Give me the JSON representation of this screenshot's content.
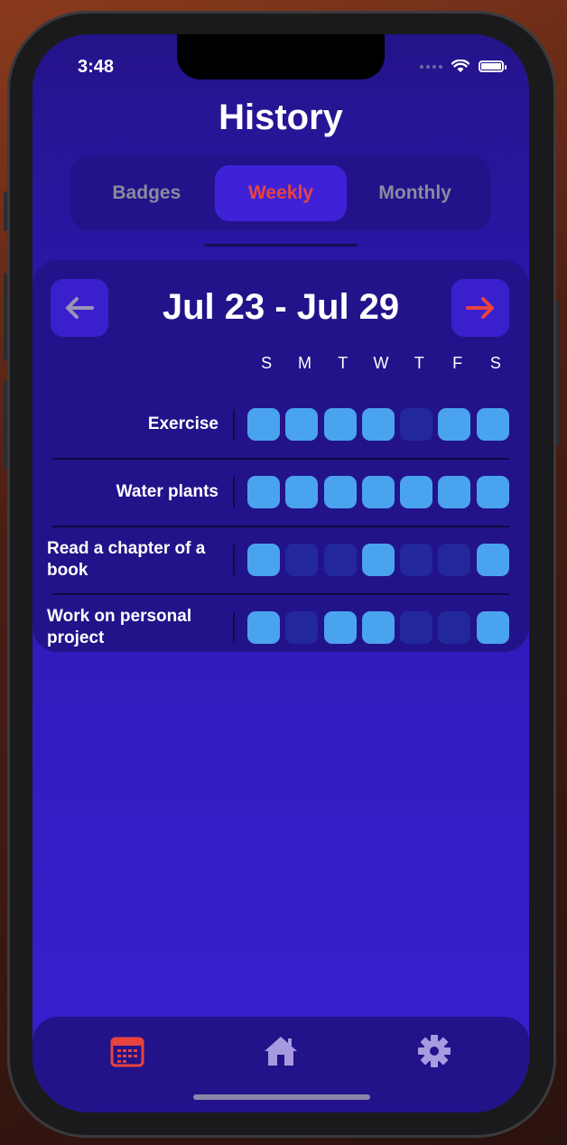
{
  "status_bar": {
    "time": "3:48"
  },
  "header": {
    "title": "History"
  },
  "tabs": [
    {
      "label": "Badges",
      "active": false
    },
    {
      "label": "Weekly",
      "active": true
    },
    {
      "label": "Monthly",
      "active": false
    }
  ],
  "week": {
    "label": "Jul 23 - Jul 29",
    "prev_icon": "arrow-left-icon",
    "next_icon": "arrow-right-icon",
    "days": [
      "S",
      "M",
      "T",
      "W",
      "T",
      "F",
      "S"
    ]
  },
  "habits": [
    {
      "name": "Exercise",
      "completed": [
        true,
        true,
        true,
        true,
        false,
        true,
        true
      ]
    },
    {
      "name": "Water plants",
      "completed": [
        true,
        true,
        true,
        true,
        true,
        true,
        true
      ]
    },
    {
      "name": "Read a chapter of a book",
      "completed": [
        true,
        false,
        false,
        true,
        false,
        false,
        true
      ]
    },
    {
      "name": "Work on personal project",
      "completed": [
        true,
        false,
        true,
        true,
        false,
        false,
        true
      ]
    }
  ],
  "bottom_nav": [
    {
      "icon": "calendar-icon",
      "active": true
    },
    {
      "icon": "home-icon",
      "active": false
    },
    {
      "icon": "gear-icon",
      "active": false
    }
  ],
  "colors": {
    "accent": "#e8433f",
    "completed": "#4aa3ee",
    "missed": "#22289a",
    "inactive_icon": "#a79ae0"
  }
}
